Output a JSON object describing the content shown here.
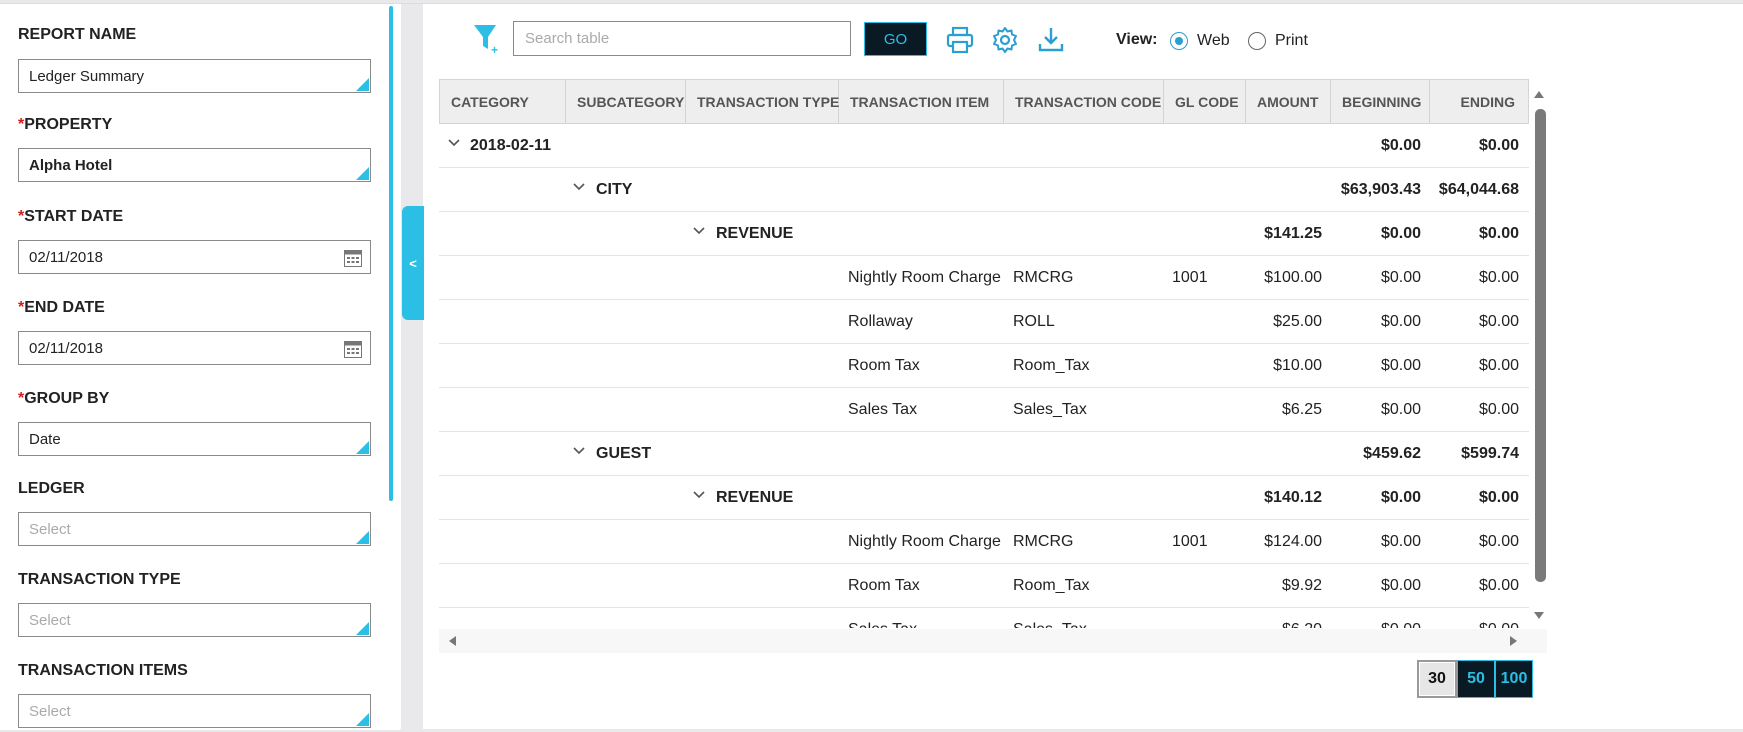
{
  "sidebar": {
    "fields": [
      {
        "label": "REPORT NAME",
        "required": false,
        "value": "Ledger Summary"
      },
      {
        "label": "PROPERTY",
        "required": true,
        "value": "Alpha Hotel"
      },
      {
        "label": "START DATE",
        "required": true,
        "value": "02/11/2018"
      },
      {
        "label": "END DATE",
        "required": true,
        "value": "02/11/2018"
      },
      {
        "label": "GROUP BY",
        "required": true,
        "value": "Date"
      },
      {
        "label": "LEDGER",
        "required": false,
        "placeholder": "Select"
      },
      {
        "label": "TRANSACTION TYPE",
        "required": false,
        "placeholder": "Select"
      },
      {
        "label": "TRANSACTION ITEMS",
        "required": false,
        "placeholder": "Select"
      }
    ],
    "required_marker": "*",
    "collapse_label": "<"
  },
  "toolbar": {
    "search_placeholder": "Search table",
    "go_label": "GO",
    "view_label": "View:",
    "view_options": [
      "Web",
      "Print"
    ],
    "view_selected": "Web"
  },
  "table": {
    "columns": [
      "CATEGORY",
      "SUBCATEGORY",
      "TRANSACTION TYPE",
      "TRANSACTION ITEM",
      "TRANSACTION CODE",
      "GL CODE",
      "AMOUNT",
      "BEGINNING",
      "ENDING"
    ],
    "rows": [
      {
        "level": 0,
        "group": "2018-02-11",
        "amount": "",
        "beginning": "$0.00",
        "ending": "$0.00"
      },
      {
        "level": 1,
        "group": "CITY",
        "amount": "",
        "beginning": "$63,903.43",
        "ending": "$64,044.68"
      },
      {
        "level": 2,
        "group": "REVENUE",
        "amount": "$141.25",
        "beginning": "$0.00",
        "ending": "$0.00"
      },
      {
        "level": 3,
        "item": "Nightly Room Charge",
        "code": "RMCRG",
        "gl": "1001",
        "amount": "$100.00",
        "beginning": "$0.00",
        "ending": "$0.00"
      },
      {
        "level": 3,
        "item": "Rollaway",
        "code": "ROLL",
        "gl": "",
        "amount": "$25.00",
        "beginning": "$0.00",
        "ending": "$0.00"
      },
      {
        "level": 3,
        "item": "Room Tax",
        "code": "Room_Tax",
        "gl": "",
        "amount": "$10.00",
        "beginning": "$0.00",
        "ending": "$0.00"
      },
      {
        "level": 3,
        "item": "Sales Tax",
        "code": "Sales_Tax",
        "gl": "",
        "amount": "$6.25",
        "beginning": "$0.00",
        "ending": "$0.00"
      },
      {
        "level": 1,
        "group": "GUEST",
        "amount": "",
        "beginning": "$459.62",
        "ending": "$599.74"
      },
      {
        "level": 2,
        "group": "REVENUE",
        "amount": "$140.12",
        "beginning": "$0.00",
        "ending": "$0.00"
      },
      {
        "level": 3,
        "item": "Nightly Room Charge",
        "code": "RMCRG",
        "gl": "1001",
        "amount": "$124.00",
        "beginning": "$0.00",
        "ending": "$0.00"
      },
      {
        "level": 3,
        "item": "Room Tax",
        "code": "Room_Tax",
        "gl": "",
        "amount": "$9.92",
        "beginning": "$0.00",
        "ending": "$0.00"
      },
      {
        "level": 3,
        "item": "Sales Tax",
        "code": "Sales_Tax",
        "gl": "",
        "amount": "$6.20",
        "beginning": "$0.00",
        "ending": "$0.00"
      }
    ]
  },
  "pager": {
    "sizes": [
      "30",
      "50",
      "100"
    ],
    "selected": "30"
  },
  "colors": {
    "accent": "#2bbfe6",
    "dark_button": "#0a1a24",
    "required": "#d81b1b"
  },
  "icons": [
    "filter-add-icon",
    "print-icon",
    "gear-icon",
    "download-icon",
    "calendar-icon",
    "chevron-down-icon"
  ]
}
